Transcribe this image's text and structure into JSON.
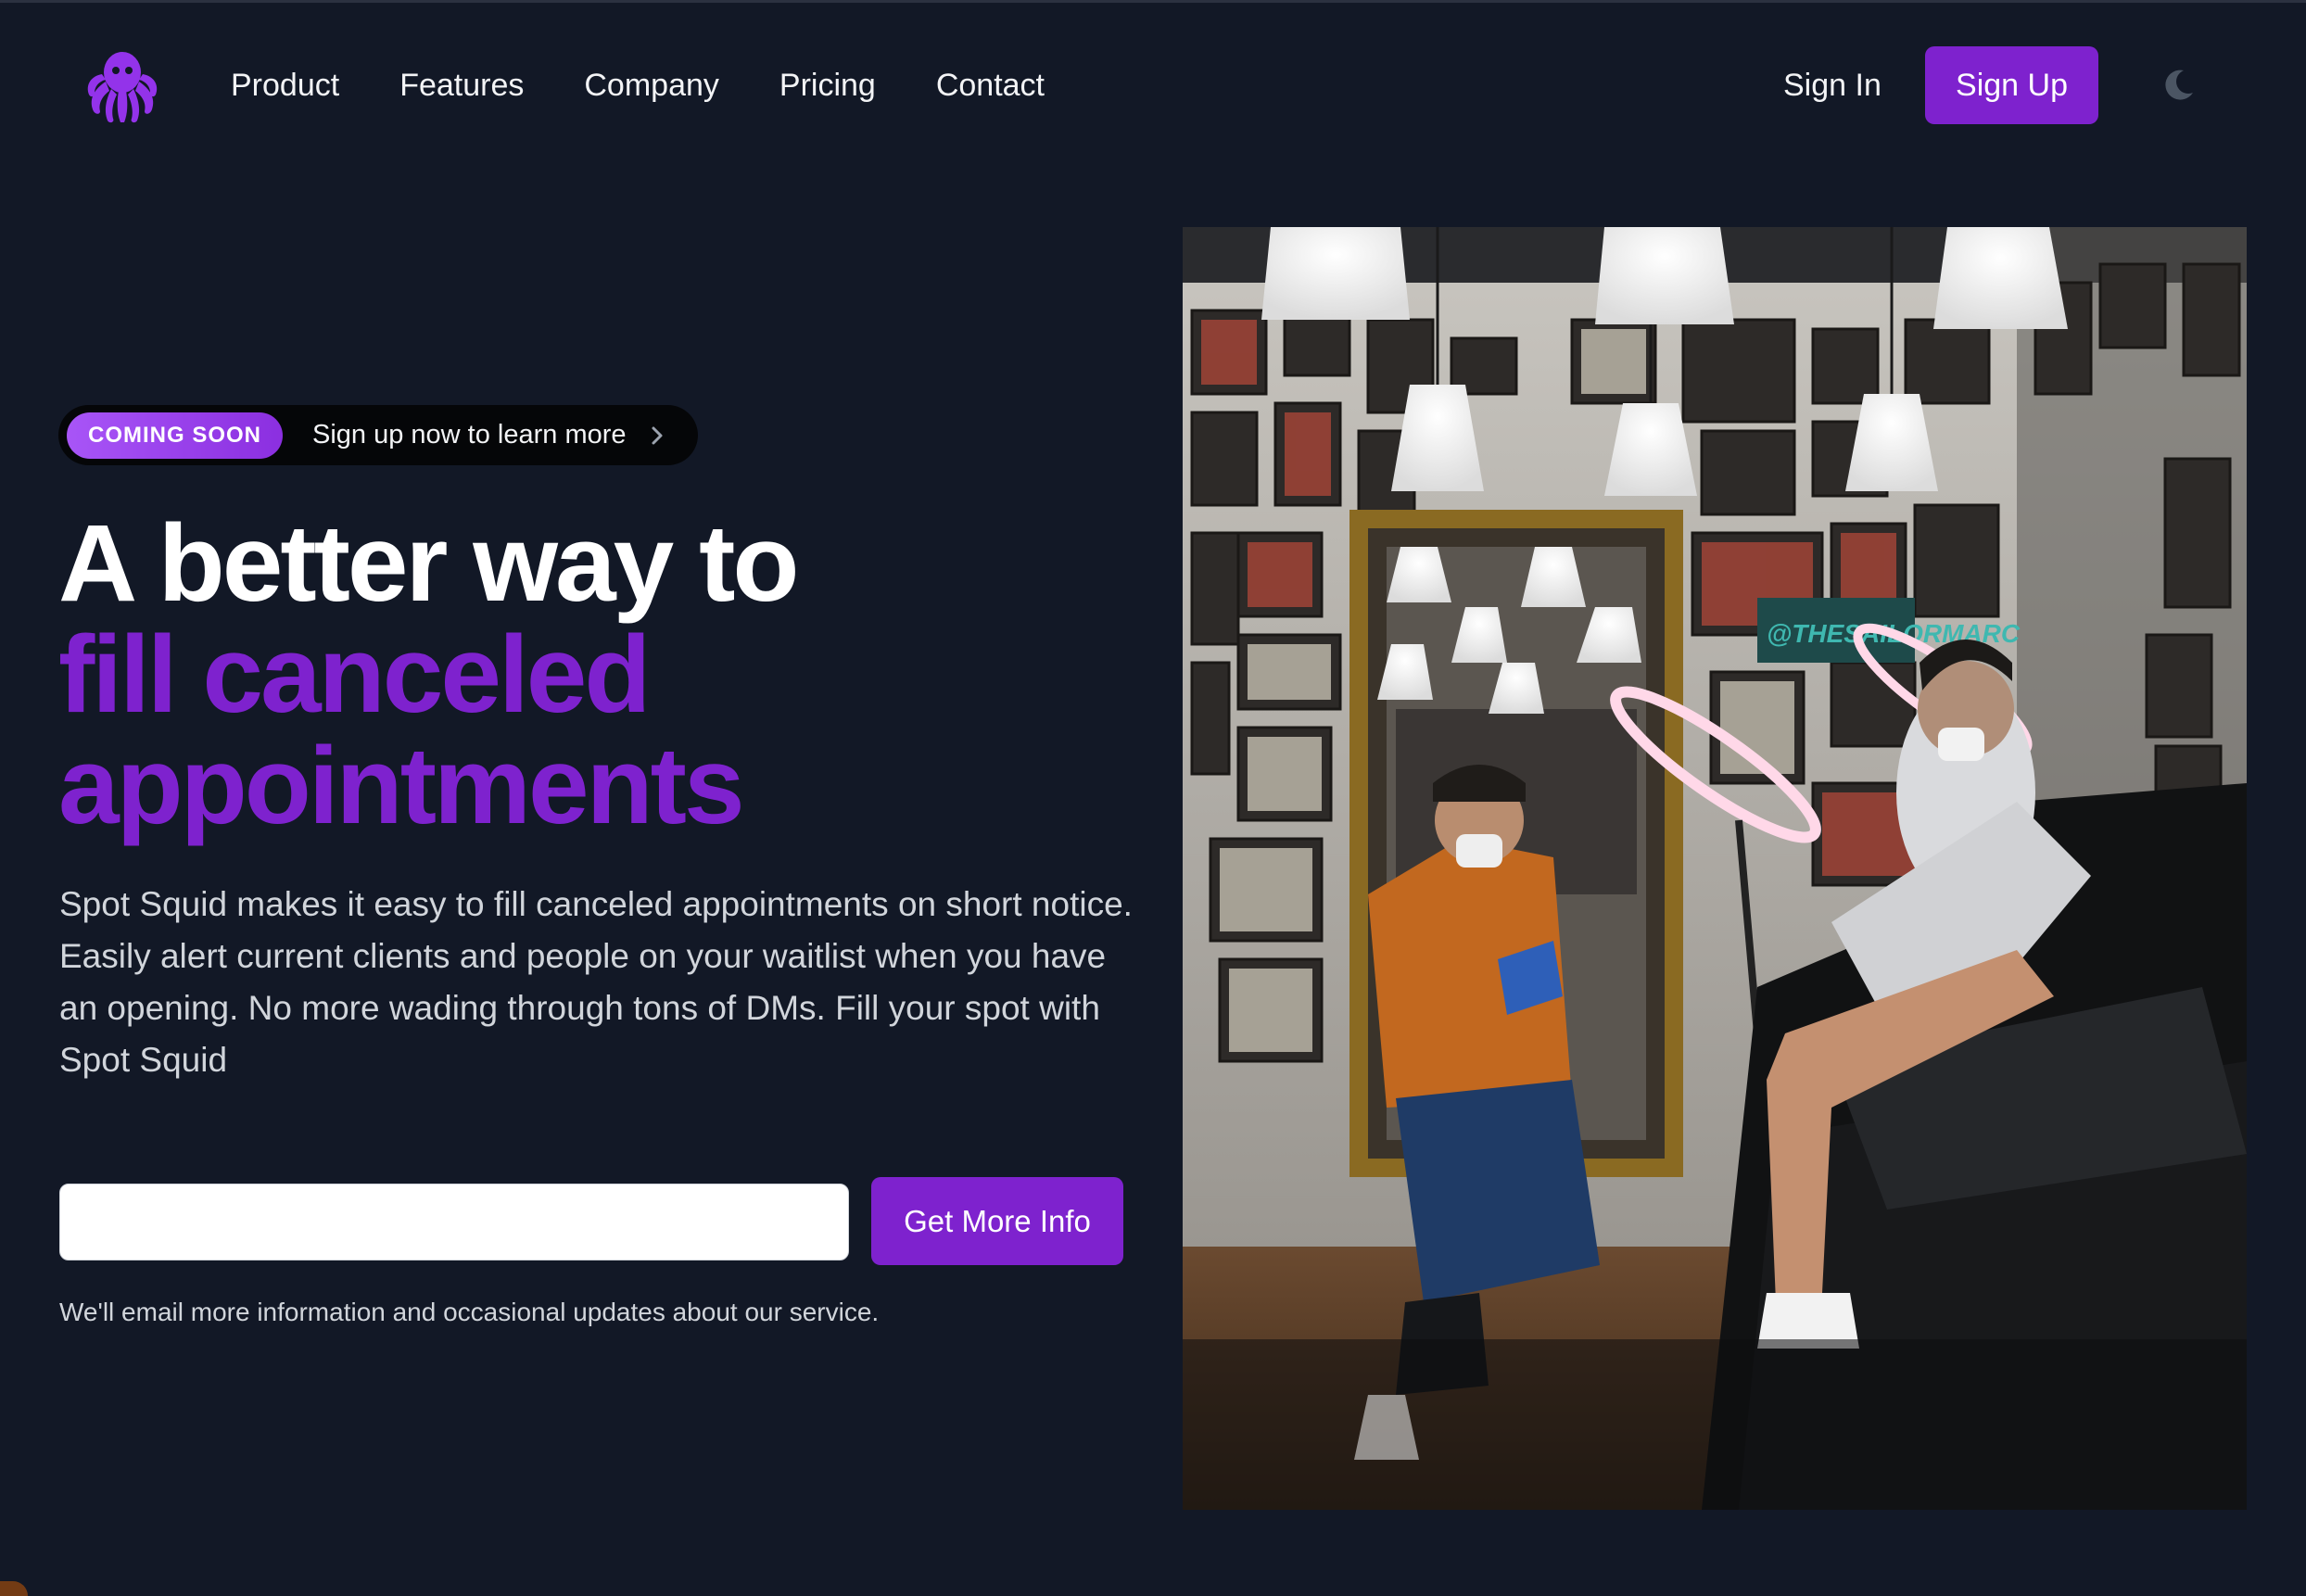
{
  "nav": {
    "logo_icon": "octopus-logo-icon",
    "links": [
      {
        "label": "Product"
      },
      {
        "label": "Features"
      },
      {
        "label": "Company"
      },
      {
        "label": "Pricing"
      },
      {
        "label": "Contact"
      }
    ],
    "sign_in": "Sign In",
    "sign_up": "Sign Up",
    "theme_icon": "moon-icon"
  },
  "hero": {
    "badge": "COMING SOON",
    "badge_text": "Sign up now to learn more",
    "headline_line1": "A better way to",
    "headline_line2": "fill canceled",
    "headline_line3": "appointments",
    "description": "Spot Squid makes it easy to fill canceled appointments on short notice. Easily alert current clients and people on your waitlist when you have an opening. No more wading through tons of DMs. Fill your spot with Spot Squid",
    "email_value": "",
    "email_placeholder": "",
    "cta": "Get More Info",
    "note": "We'll email more information and occasional updates about our service.",
    "photo_text": "@THESAILORMARC"
  },
  "colors": {
    "background": "#121826",
    "accent": "#7e22ce",
    "badge_gradient_start": "#a855f7"
  }
}
